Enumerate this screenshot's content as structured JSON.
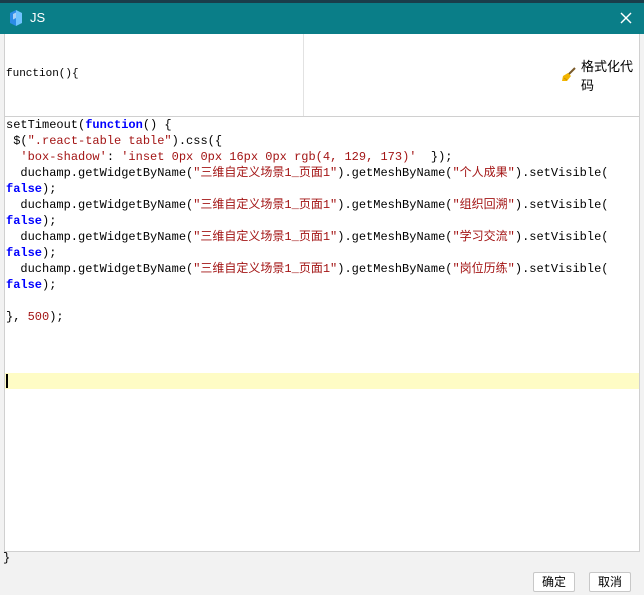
{
  "window": {
    "title": "JS",
    "app_icon": "cube-app-icon",
    "close_icon": "close-icon"
  },
  "header": {
    "function_signature": "function(){",
    "format_button": {
      "label": "格式化代码",
      "icon": "broom-icon"
    }
  },
  "editor": {
    "lines": [
      [
        {
          "t": "fnc",
          "v": "setTimeout("
        },
        {
          "t": "kw",
          "v": "function"
        },
        {
          "t": "fnc",
          "v": "() {"
        }
      ],
      [
        {
          "t": "fnc",
          "v": " $("
        },
        {
          "t": "str",
          "v": "\".react-table table\""
        },
        {
          "t": "fnc",
          "v": ").css({"
        }
      ],
      [
        {
          "t": "fnc",
          "v": "  "
        },
        {
          "t": "str",
          "v": "'box-shadow'"
        },
        {
          "t": "fnc",
          "v": ": "
        },
        {
          "t": "str",
          "v": "'inset 0px 0px 16px 0px rgb(4, 129, 173)'"
        },
        {
          "t": "fnc",
          "v": "  });"
        }
      ],
      [
        {
          "t": "fnc",
          "v": "  duchamp.getWidgetByName("
        },
        {
          "t": "str",
          "v": "\"三维自定义场景1_页面1\""
        },
        {
          "t": "fnc",
          "v": ").getMeshByName("
        },
        {
          "t": "str",
          "v": "\"个人成果\""
        },
        {
          "t": "fnc",
          "v": ").setVisible("
        }
      ],
      [
        {
          "t": "kw",
          "v": "false"
        },
        {
          "t": "fnc",
          "v": ");"
        }
      ],
      [
        {
          "t": "fnc",
          "v": "  duchamp.getWidgetByName("
        },
        {
          "t": "str",
          "v": "\"三维自定义场景1_页面1\""
        },
        {
          "t": "fnc",
          "v": ").getMeshByName("
        },
        {
          "t": "str",
          "v": "\"组织回溯\""
        },
        {
          "t": "fnc",
          "v": ").setVisible("
        }
      ],
      [
        {
          "t": "kw",
          "v": "false"
        },
        {
          "t": "fnc",
          "v": ");"
        }
      ],
      [
        {
          "t": "fnc",
          "v": "  duchamp.getWidgetByName("
        },
        {
          "t": "str",
          "v": "\"三维自定义场景1_页面1\""
        },
        {
          "t": "fnc",
          "v": ").getMeshByName("
        },
        {
          "t": "str",
          "v": "\"学习交流\""
        },
        {
          "t": "fnc",
          "v": ").setVisible("
        }
      ],
      [
        {
          "t": "kw",
          "v": "false"
        },
        {
          "t": "fnc",
          "v": ");"
        }
      ],
      [
        {
          "t": "fnc",
          "v": "  duchamp.getWidgetByName("
        },
        {
          "t": "str",
          "v": "\"三维自定义场景1_页面1\""
        },
        {
          "t": "fnc",
          "v": ").getMeshByName("
        },
        {
          "t": "str",
          "v": "\"岗位历练\""
        },
        {
          "t": "fnc",
          "v": ").setVisible("
        }
      ],
      [
        {
          "t": "kw",
          "v": "false"
        },
        {
          "t": "fnc",
          "v": ");"
        }
      ],
      [],
      [
        {
          "t": "fnc",
          "v": "}, "
        },
        {
          "t": "str",
          "v": "500"
        },
        {
          "t": "fnc",
          "v": ");"
        }
      ]
    ],
    "closing_brace": "}"
  },
  "footer": {
    "ok_label": "确定",
    "cancel_label": "取消"
  },
  "colors": {
    "titlebar": "#0a7e88",
    "keyword": "#0000ff",
    "string": "#a31515",
    "active_line": "#fefcc5"
  }
}
